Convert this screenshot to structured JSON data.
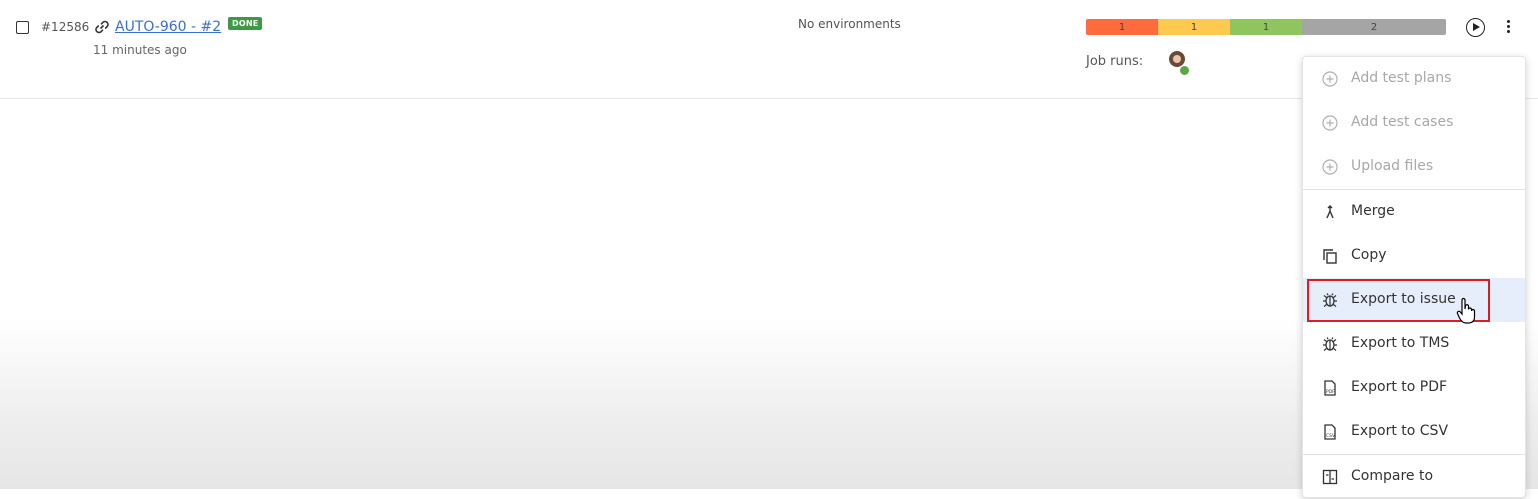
{
  "run": {
    "id": "#12586",
    "title": "AUTO-960 - #2",
    "status_badge": "DONE",
    "time_ago": "11 minutes ago",
    "environments": "No environments",
    "job_runs_label": "Job runs:"
  },
  "status_bar": [
    {
      "value": "1",
      "color": "#ff6b3d",
      "fraction": 0.2
    },
    {
      "value": "1",
      "color": "#fdc94f",
      "fraction": 0.2
    },
    {
      "value": "1",
      "color": "#8fc45e",
      "fraction": 0.2
    },
    {
      "value": "2",
      "color": "#a5a5a5",
      "fraction": 0.4
    }
  ],
  "menu": {
    "items": [
      {
        "label": "Add test plans",
        "icon": "add-circle-icon",
        "disabled": true
      },
      {
        "label": "Add test cases",
        "icon": "add-circle-icon",
        "disabled": true
      },
      {
        "label": "Upload files",
        "icon": "add-circle-icon",
        "disabled": true
      },
      {
        "label": "Merge",
        "icon": "merge-icon",
        "disabled": false
      },
      {
        "label": "Copy",
        "icon": "copy-icon",
        "disabled": false
      },
      {
        "label": "Export to issue",
        "icon": "bug-icon",
        "disabled": false,
        "highlighted": true
      },
      {
        "label": "Export to TMS",
        "icon": "bug-icon",
        "disabled": false
      },
      {
        "label": "Export to PDF",
        "icon": "pdf-file-icon",
        "disabled": false
      },
      {
        "label": "Export to CSV",
        "icon": "csv-file-icon",
        "disabled": false
      },
      {
        "label": "Compare to",
        "icon": "compare-icon",
        "disabled": false
      }
    ]
  }
}
